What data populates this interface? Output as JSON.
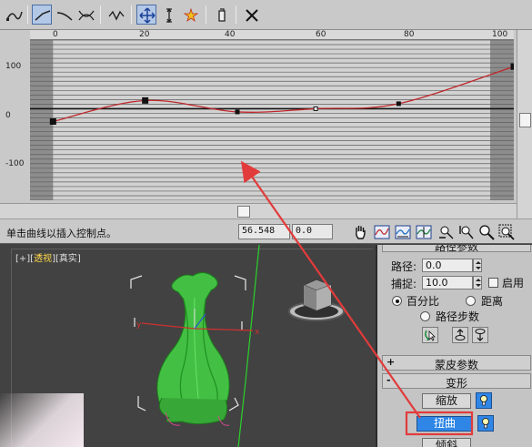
{
  "toolbar": {
    "icons": [
      "curve-icon",
      "linear-curve-icon",
      "smooth-curve-icon",
      "insert-point-icon",
      "sine-wave-icon",
      "move-control-point-icon",
      "scale-point-icon",
      "insert-corner-icon",
      "delete-point-icon",
      "reset-curve-icon"
    ]
  },
  "graph": {
    "x_ticks": [
      "0",
      "20",
      "40",
      "60",
      "80",
      "100"
    ],
    "y_ticks": [
      "100",
      "0",
      "-100"
    ]
  },
  "chart_data": {
    "type": "line",
    "x": [
      0,
      20,
      40,
      57,
      75,
      100
    ],
    "y": [
      -28,
      18,
      -7,
      0,
      11,
      92
    ],
    "xlim": [
      -5,
      100
    ],
    "ylim": [
      -200,
      150
    ],
    "grid": true,
    "curve_color": "#c0282c"
  },
  "status": {
    "message": "单击曲线以插入控制点。",
    "x_value": "56.548",
    "y_value": "0.0"
  },
  "viewport": {
    "label_prefix": "[+][",
    "label_view": "透视",
    "label_mid": "][",
    "label_shade": "真实",
    "label_suffix": "]"
  },
  "panel": {
    "header_partial": "路径参数",
    "path_label": "路径:",
    "path_value": "0.0",
    "snap_label": "捕捉:",
    "snap_value": "10.0",
    "enable_label": "启用",
    "percent_label": "百分比",
    "distance_label": "距离",
    "path_steps_label": "路径步数",
    "skin_rollout": "蒙皮参数",
    "deform_rollout": "变形",
    "scale_button": "缩放",
    "twist_button": "扭曲",
    "tilt_partial": "倾斜"
  },
  "colors": {
    "accent_blue": "#2f86e6",
    "annotation_red": "#e23b3b",
    "curve_red": "#c0282c",
    "vase_green": "#3fbf3f"
  }
}
